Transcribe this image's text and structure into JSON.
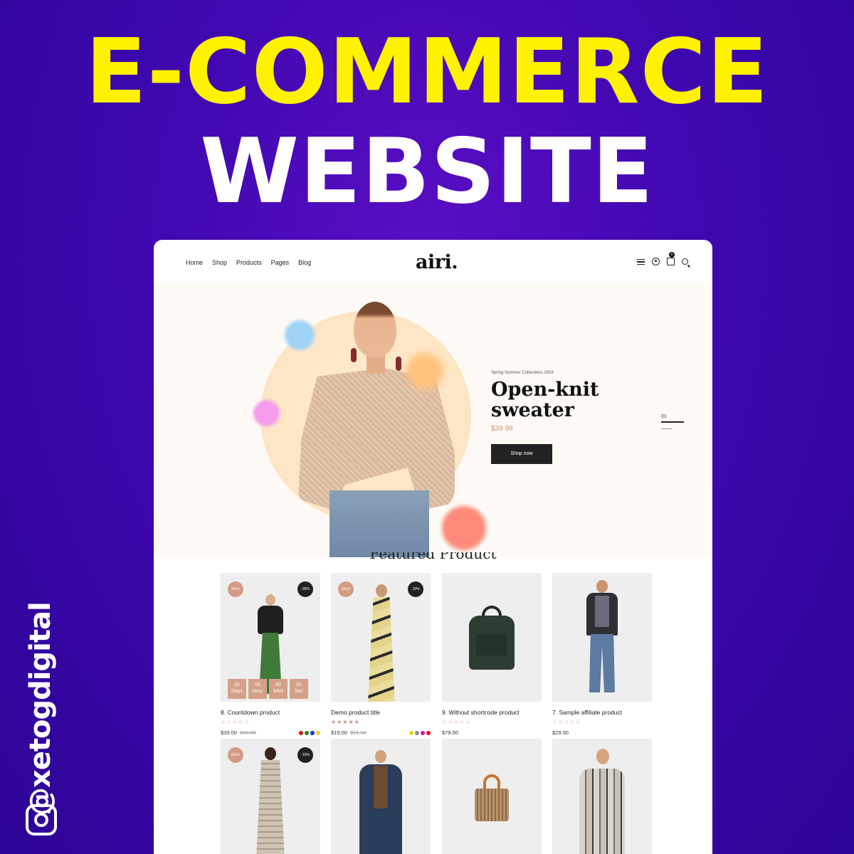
{
  "promo": {
    "headline_1": "E-COMMERCE",
    "headline_2": "WEBSITE",
    "handle": "@xetogdigital",
    "handle_icon": "instagram-icon",
    "colors": {
      "accent_yellow": "#fff200",
      "bg_purple": "#3f08b0"
    }
  },
  "nav": {
    "links": [
      "Home",
      "Shop",
      "Products",
      "Pages",
      "Blog"
    ],
    "logo": "airi.",
    "icons": [
      "menu-icon",
      "user-icon",
      "cart-icon",
      "search-icon"
    ],
    "cart_count": "0"
  },
  "hero": {
    "eyebrow": "Spring Summer Collections 2018",
    "title": "Open-knit sweater",
    "price": "$39.99",
    "button": "Shop now",
    "slide_number": "01"
  },
  "featured": {
    "title": "Featured Product"
  },
  "products": [
    {
      "name": "8. Countdown product",
      "price": "$39.00",
      "old_price": "$60.00",
      "sale": "SALE",
      "discount": "-35%",
      "stars": "☆☆☆☆☆",
      "countdown": [
        [
          "00",
          "Days"
        ],
        [
          "00",
          "Hour"
        ],
        [
          "00",
          "Mint"
        ],
        [
          "00",
          "Sec"
        ]
      ],
      "swatches": [
        "#d11b1b",
        "#1b8a2a",
        "#1b2fd1",
        "#f2d21b"
      ]
    },
    {
      "name": "Demo product title",
      "price": "$19.00",
      "old_price": "$21.00",
      "sale": "SALE",
      "discount": "-10%",
      "stars": "★★★★★",
      "swatches": [
        "#f2d21b",
        "#8a8a8a",
        "#d11bb4",
        "#d11b1b"
      ]
    },
    {
      "name": "9. Without shortcode product",
      "price": "$79.00",
      "stars": "☆☆☆☆☆"
    },
    {
      "name": "7. Sample affiliate product",
      "price": "$29.00",
      "stars": "☆☆☆☆☆"
    },
    {
      "sale": "SALE",
      "discount": "-15%"
    },
    {},
    {},
    {}
  ]
}
